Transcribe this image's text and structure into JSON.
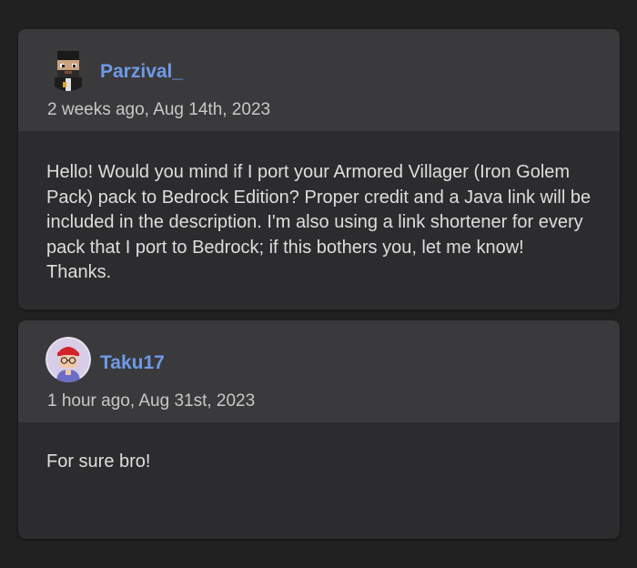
{
  "comments": [
    {
      "author": "Parzival_",
      "timestamp": "2 weeks ago, Aug 14th, 2023",
      "avatar_icon": "pixel-character-avatar-icon",
      "body": "Hello! Would you mind if I port your Armored Villager (Iron Golem Pack) pack to Bedrock Edition? Proper credit and a Java link will be included in the description. I'm also using a link shortener for every pack that I port to Bedrock; if this bothers you, let me know! Thanks."
    },
    {
      "author": "Taku17",
      "timestamp": "1 hour ago, Aug 31st, 2023",
      "avatar_icon": "cartoon-character-avatar-icon",
      "body": "For sure bro!"
    }
  ],
  "colors": {
    "page_background": "#212121",
    "card_background": "#2c2c2e",
    "header_background": "#3a3a3c",
    "author_link": "#6f9ae8",
    "body_text": "#dedede"
  }
}
